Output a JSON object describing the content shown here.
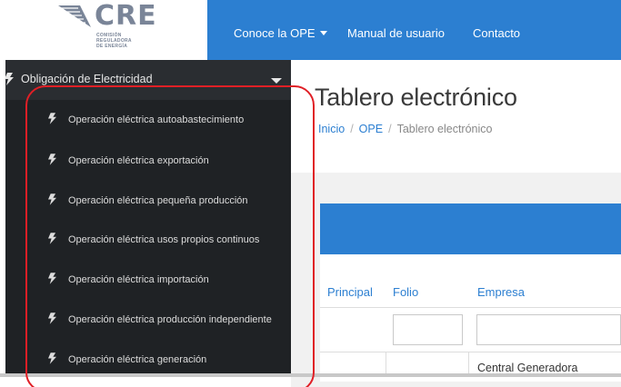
{
  "logo": {
    "text": "CRE",
    "subtitle": [
      "COMISIÓN",
      "REGULADORA",
      "DE ENERGÍA"
    ]
  },
  "topnav": {
    "items": [
      {
        "label": "Conoce la OPE",
        "has_dropdown": true
      },
      {
        "label": "Manual de usuario",
        "has_dropdown": false
      },
      {
        "label": "Contacto",
        "has_dropdown": false
      }
    ]
  },
  "sidebar": {
    "header": {
      "label": "Obligación de Electricidad",
      "icon": "bolt-icon",
      "expanded": true
    },
    "items": [
      {
        "label": "Operación eléctrica autoabastecimiento",
        "icon": "bolt-icon"
      },
      {
        "label": "Operación eléctrica exportación",
        "icon": "bolt-icon"
      },
      {
        "label": "Operación eléctrica pequeña producción",
        "icon": "bolt-icon"
      },
      {
        "label": "Operación eléctrica usos propios continuos",
        "icon": "bolt-icon"
      },
      {
        "label": "Operación eléctrica importación",
        "icon": "bolt-icon"
      },
      {
        "label": "Operación eléctrica producción independiente",
        "icon": "bolt-icon"
      },
      {
        "label": "Operación eléctrica generación",
        "icon": "bolt-icon"
      }
    ]
  },
  "main": {
    "title": "Tablero electrónico",
    "breadcrumb": [
      "Inicio",
      "OPE",
      "Tablero electrónico"
    ],
    "table": {
      "columns": [
        "Principal",
        "Folio",
        "Empresa"
      ],
      "first_row": {
        "empresa": "Central Generadora"
      }
    }
  },
  "colors": {
    "brand_blue": "#2c7fd1",
    "sidebar_bg": "#1f2225",
    "annotation_red": "#e01f26"
  }
}
